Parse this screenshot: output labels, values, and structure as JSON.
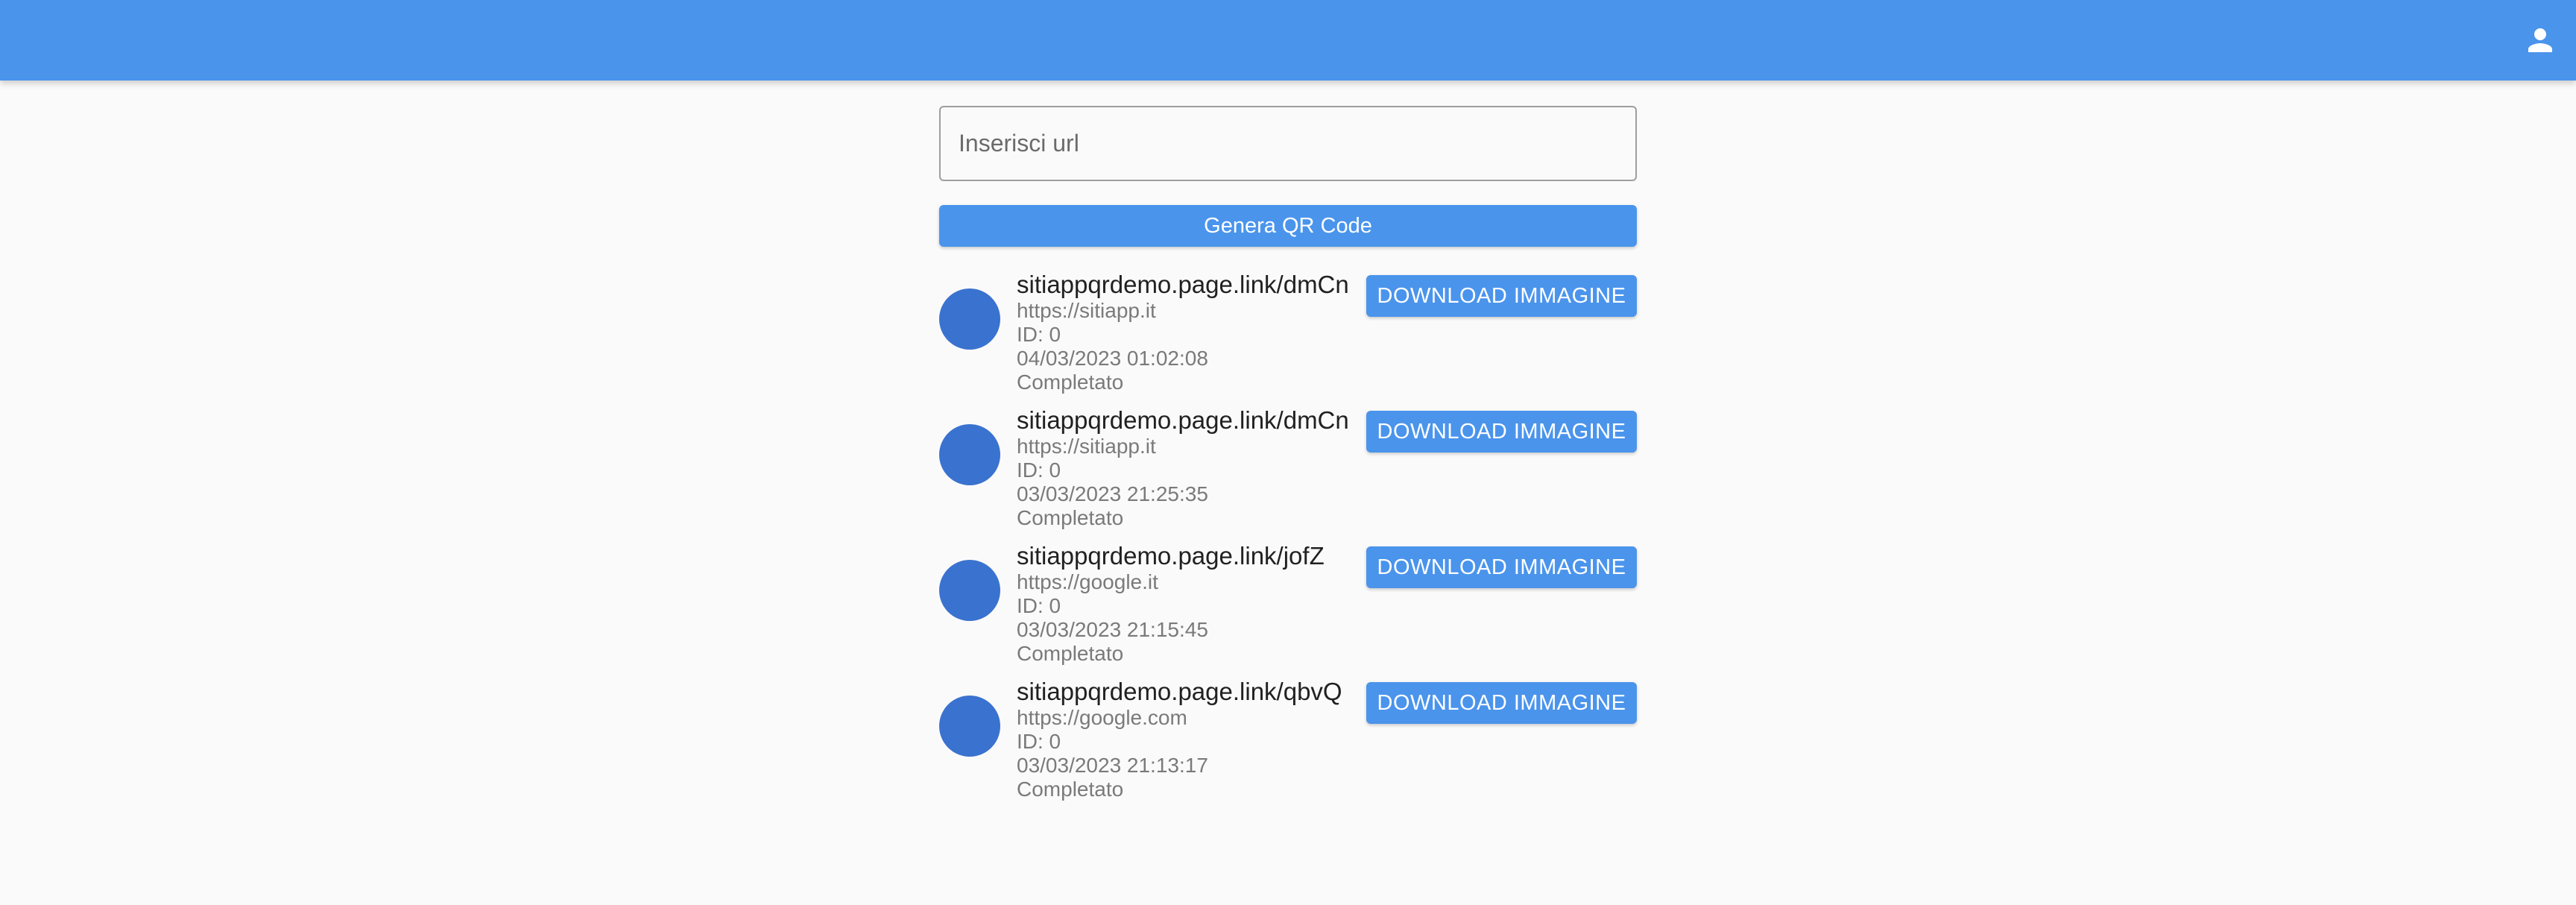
{
  "appbar": {
    "color": "#4a94ec",
    "account_icon": "person-icon"
  },
  "form": {
    "url_placeholder": "Inserisci url",
    "url_value": "",
    "generate_label": "Genera QR Code"
  },
  "items": [
    {
      "short_link": "sitiappqrdemo.page.link/dmCn",
      "url": "https://sitiapp.it",
      "id": "ID: 0",
      "timestamp": "04/03/2023 01:02:08",
      "status": "Completato",
      "download_label": "DOWNLOAD IMMAGINE"
    },
    {
      "short_link": "sitiappqrdemo.page.link/dmCn",
      "url": "https://sitiapp.it",
      "id": "ID: 0",
      "timestamp": "03/03/2023 21:25:35",
      "status": "Completato",
      "download_label": "DOWNLOAD IMMAGINE"
    },
    {
      "short_link": "sitiappqrdemo.page.link/jofZ",
      "url": "https://google.it",
      "id": "ID: 0",
      "timestamp": "03/03/2023 21:15:45",
      "status": "Completato",
      "download_label": "DOWNLOAD IMMAGINE"
    },
    {
      "short_link": "sitiappqrdemo.page.link/qbvQ",
      "url": "https://google.com",
      "id": "ID: 0",
      "timestamp": "03/03/2023 21:13:17",
      "status": "Completato",
      "download_label": "DOWNLOAD IMMAGINE"
    }
  ]
}
